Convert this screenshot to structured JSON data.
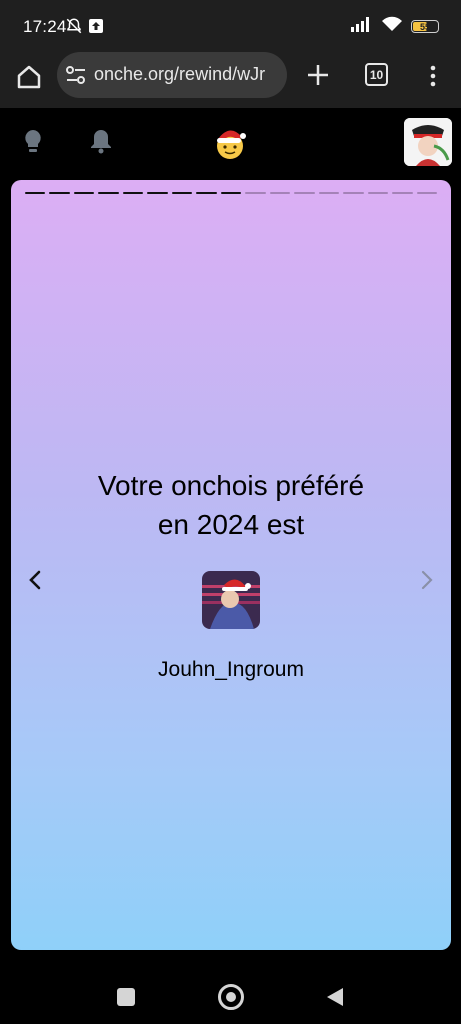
{
  "status_bar": {
    "time": "17:24",
    "battery_level": "55",
    "battery_fill": 0.55
  },
  "browser": {
    "url": "onche.org/rewind/wJr",
    "tab_count": "10"
  },
  "story": {
    "progress_total": 17,
    "progress_done": 9,
    "heading_line1": "Votre onchois préféré",
    "heading_line2": "en 2024 est",
    "username": "Jouhn_Ingroum"
  },
  "colors": {
    "gradient_top": "#dcaef4",
    "gradient_bottom": "#8fd0f9",
    "browser_bar": "#1f1f1f",
    "url_box": "#3a3a3a"
  }
}
